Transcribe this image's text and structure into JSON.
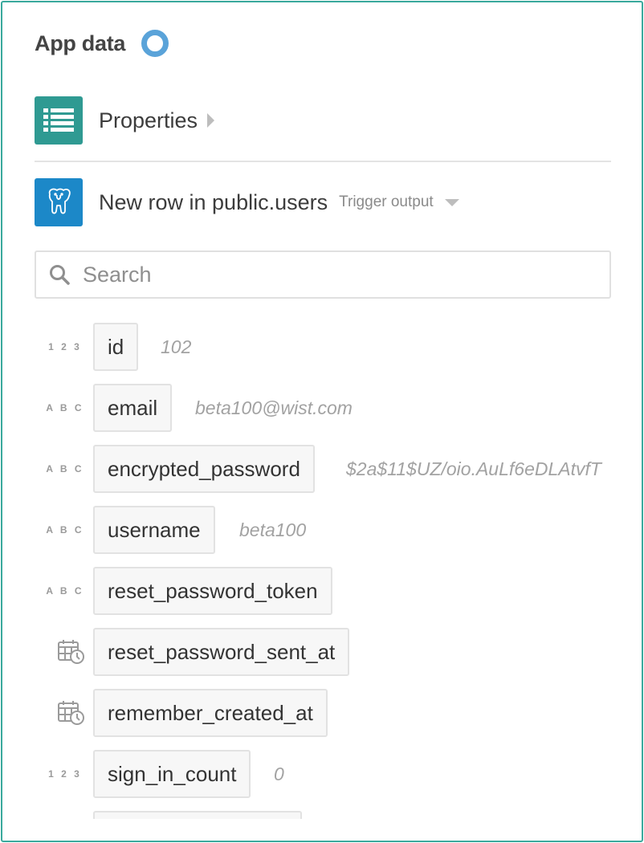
{
  "header": {
    "title": "App data"
  },
  "properties": {
    "label": "Properties",
    "icon": "list-icon"
  },
  "trigger": {
    "label": "New row in public.users",
    "dropdown_label": "Trigger output",
    "icon": "postgresql-elephant-icon",
    "color": "#1c88c8"
  },
  "search": {
    "placeholder": "Search",
    "value": ""
  },
  "fields": [
    {
      "type": "1 2 3",
      "name": "id",
      "value": "102"
    },
    {
      "type": "A B C",
      "name": "email",
      "value": "beta100@wist.com"
    },
    {
      "type": "A B C",
      "name": "encrypted_password",
      "value": "$2a$11$UZ/oio.AuLf6eDLAtvfT"
    },
    {
      "type": "A B C",
      "name": "username",
      "value": "beta100"
    },
    {
      "type": "A B C",
      "name": "reset_password_token",
      "value": ""
    },
    {
      "type": "calendar-clock-icon",
      "name": "reset_password_sent_at",
      "value": ""
    },
    {
      "type": "calendar-clock-icon",
      "name": "remember_created_at",
      "value": ""
    },
    {
      "type": "1 2 3",
      "name": "sign_in_count",
      "value": "0"
    },
    {
      "type": "",
      "name": "",
      "value": ""
    }
  ],
  "colors": {
    "accent": "#39a89c",
    "properties_icon": "#2f9a92",
    "ring": "#5aa3d9"
  }
}
